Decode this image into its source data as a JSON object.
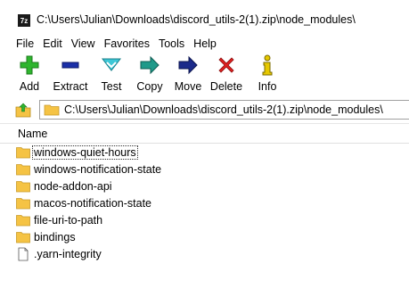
{
  "window": {
    "title": "C:\\Users\\Julian\\Downloads\\discord_utils-2(1).zip\\node_modules\\",
    "app_icon_text": "7z"
  },
  "menu": [
    "File",
    "Edit",
    "View",
    "Favorites",
    "Tools",
    "Help"
  ],
  "toolbar": {
    "add": "Add",
    "extract": "Extract",
    "test": "Test",
    "copy": "Copy",
    "move": "Move",
    "delete": "Delete",
    "info": "Info"
  },
  "address": {
    "path": "C:\\Users\\Julian\\Downloads\\discord_utils-2(1).zip\\node_modules\\"
  },
  "list": {
    "header_name": "Name",
    "items": [
      {
        "name": "windows-quiet-hours",
        "type": "folder"
      },
      {
        "name": "windows-notification-state",
        "type": "folder"
      },
      {
        "name": "node-addon-api",
        "type": "folder"
      },
      {
        "name": "macos-notification-state",
        "type": "folder"
      },
      {
        "name": "file-uri-to-path",
        "type": "folder"
      },
      {
        "name": "bindings",
        "type": "folder"
      },
      {
        "name": ".yarn-integrity",
        "type": "file"
      }
    ]
  },
  "colors": {
    "folder": "#f5c344",
    "add_icon": "#2fb52f",
    "extract_icon": "#1b2fa8",
    "test_icon": "#3cc7d6",
    "copy_icon": "#1f9a8a",
    "move_icon": "#1b2a8a",
    "delete_icon": "#e02020",
    "info_icon": "#d4b400"
  }
}
